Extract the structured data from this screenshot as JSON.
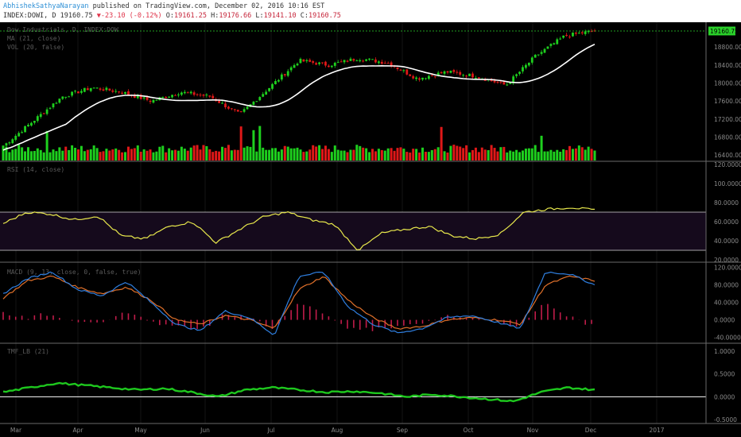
{
  "header": {
    "author": "AbhishekSathyaNarayan",
    "published": "published on TradingView.com, December 02, 2016 10:16 EST",
    "symbol": "INDEX:DOWI, D",
    "last": "19160.75",
    "arrow": "▼",
    "change": "-23.10 (-0.12%)",
    "ohlc_o_label": "O:",
    "ohlc_o": "19161.25",
    "ohlc_h_label": "H:",
    "ohlc_h": "19176.66",
    "ohlc_l_label": "L:",
    "ohlc_l": "19141.10",
    "ohlc_c_label": "C:",
    "ohlc_c": "19160.75"
  },
  "colors": {
    "background": "#000000",
    "up": "#1ed01e",
    "down": "#e01818",
    "ma": "#ffffff",
    "rsi": "#e8e84c",
    "rsi_band": "#150a1c",
    "macd": "#2f7fe0",
    "signal": "#e0702a",
    "hist": "#c01c4a",
    "tmf": "#1ec81e",
    "last_line": "#2ad22a"
  },
  "chart_data": [
    {
      "type": "candlestick",
      "title": "Dow Industrials, D, INDEX:DOW",
      "overlays": [
        "MA (21, close)",
        "VOL (20, false)"
      ],
      "x_ticks": [
        "Mar",
        "Apr",
        "May",
        "Jun",
        "Jul",
        "Aug",
        "Sep",
        "Oct",
        "Nov",
        "Dec",
        "2017"
      ],
      "y_ticks": [
        16400,
        16800,
        17200,
        17600,
        18000,
        18400,
        18800
      ],
      "ylim": [
        16280,
        19280
      ],
      "last_value": "19160.75",
      "close_by_month": {
        "Mar-01": 16600,
        "Mar-15": 17150,
        "Apr-01": 17700,
        "Apr-15": 17900,
        "May-01": 17800,
        "May-15": 17600,
        "Jun-01": 17800,
        "Jun-15": 17700,
        "Jun-27": 17300,
        "Jul-01": 17900,
        "Jul-15": 18500,
        "Aug-01": 18400,
        "Aug-15": 18550,
        "Sep-01": 18450,
        "Sep-09": 18100,
        "Oct-01": 18250,
        "Oct-15": 18150,
        "Nov-01": 17950,
        "Nov-09": 18600,
        "Nov-22": 19050,
        "Dec-02": 19160.75
      }
    },
    {
      "type": "line",
      "title": "RSI (14, close)",
      "y_ticks": [
        "120.0000",
        "100.0000",
        "80.0000",
        "60.0000",
        "40.0000",
        "20.0000"
      ],
      "bands": [
        30,
        70
      ],
      "ylim": [
        20,
        120
      ],
      "approx_values": [
        58,
        70,
        68,
        62,
        66,
        45,
        42,
        55,
        60,
        38,
        52,
        65,
        70,
        62,
        57,
        30,
        48,
        52,
        55,
        45,
        42,
        47,
        70,
        73,
        75,
        72
      ]
    },
    {
      "type": "line",
      "title": "MACD (9, 13, close, 0, false, true)",
      "y_ticks": [
        "120.0000",
        "80.0000",
        "40.0000",
        "0.0000",
        "-40.0000"
      ],
      "ylim": [
        -50,
        125
      ],
      "series": [
        {
          "name": "MACD",
          "approx_values": [
            60,
            95,
            110,
            70,
            55,
            88,
            40,
            -10,
            -25,
            20,
            5,
            -35,
            100,
            110,
            30,
            -10,
            -30,
            -20,
            5,
            10,
            -5,
            -20,
            110,
            105,
            80
          ]
        },
        {
          "name": "Signal",
          "approx_values": [
            50,
            90,
            100,
            75,
            60,
            75,
            45,
            0,
            -10,
            10,
            0,
            -20,
            70,
            100,
            45,
            5,
            -20,
            -15,
            0,
            5,
            0,
            -10,
            80,
            100,
            90
          ]
        }
      ]
    },
    {
      "type": "line",
      "title": "TMF_LB (21)",
      "y_ticks": [
        "1.0000",
        "0.5000",
        "0.0000",
        "-0.5000"
      ],
      "ylim": [
        -0.55,
        1.1
      ],
      "approx_values": [
        0.1,
        0.2,
        0.3,
        0.25,
        0.2,
        0.15,
        0.18,
        0.1,
        0.0,
        0.15,
        0.2,
        0.15,
        0.1,
        0.12,
        0.08,
        0.0,
        0.05,
        0.0,
        -0.05,
        -0.1,
        0.1,
        0.2,
        0.15
      ]
    }
  ]
}
